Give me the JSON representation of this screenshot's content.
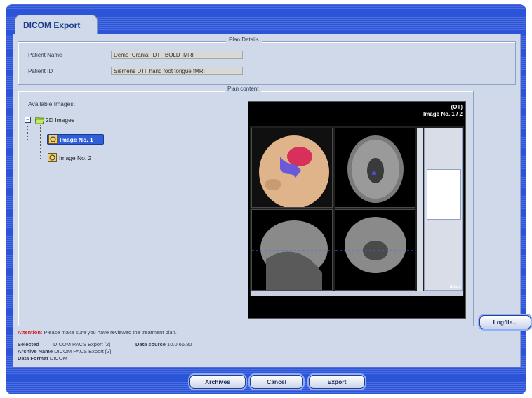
{
  "tab": {
    "label": "DICOM Export"
  },
  "plan_details": {
    "title": "Plan Details",
    "patient_name_label": "Patient Name",
    "patient_name_value": "Demo_Cranial_DTI_BOLD_MRI",
    "patient_id_label": "Patient ID",
    "patient_id_value": "Siemens DTI, hand foot tongue fMRI"
  },
  "plan_content": {
    "title": "Plan content",
    "available_label": "Available Images:",
    "tree": {
      "root_label": "2D Images",
      "expander": "−",
      "items": [
        {
          "label": "Image No. 1"
        },
        {
          "label": "Image No. 2"
        }
      ]
    },
    "preview": {
      "modality": "(OT)",
      "image_counter": "Image No. 1 / 2",
      "brand": "iPlan"
    }
  },
  "logfile_button": "Logfile...",
  "attention": {
    "prefix": "Attention:",
    "message": "Please make sure you have reviewed the treatment plan."
  },
  "export_info": {
    "selected_label": "Selected",
    "selected_value": "DICOM PACS Export [2]",
    "datasource_label": "Data source",
    "datasource_value": "10.0.66.80",
    "archive_label": "Archive Name",
    "archive_value": "DICOM PACS Export [2]",
    "format_label": "Data Format",
    "format_value": "DICOM"
  },
  "buttons": {
    "archives": "Archives",
    "cancel": "Cancel",
    "export": "Export"
  },
  "colors": {
    "band_blue": "#2b54d8",
    "panel_bg": "#cfd9ea",
    "selection": "#2f5fd8",
    "attention": "#d81e1e"
  }
}
